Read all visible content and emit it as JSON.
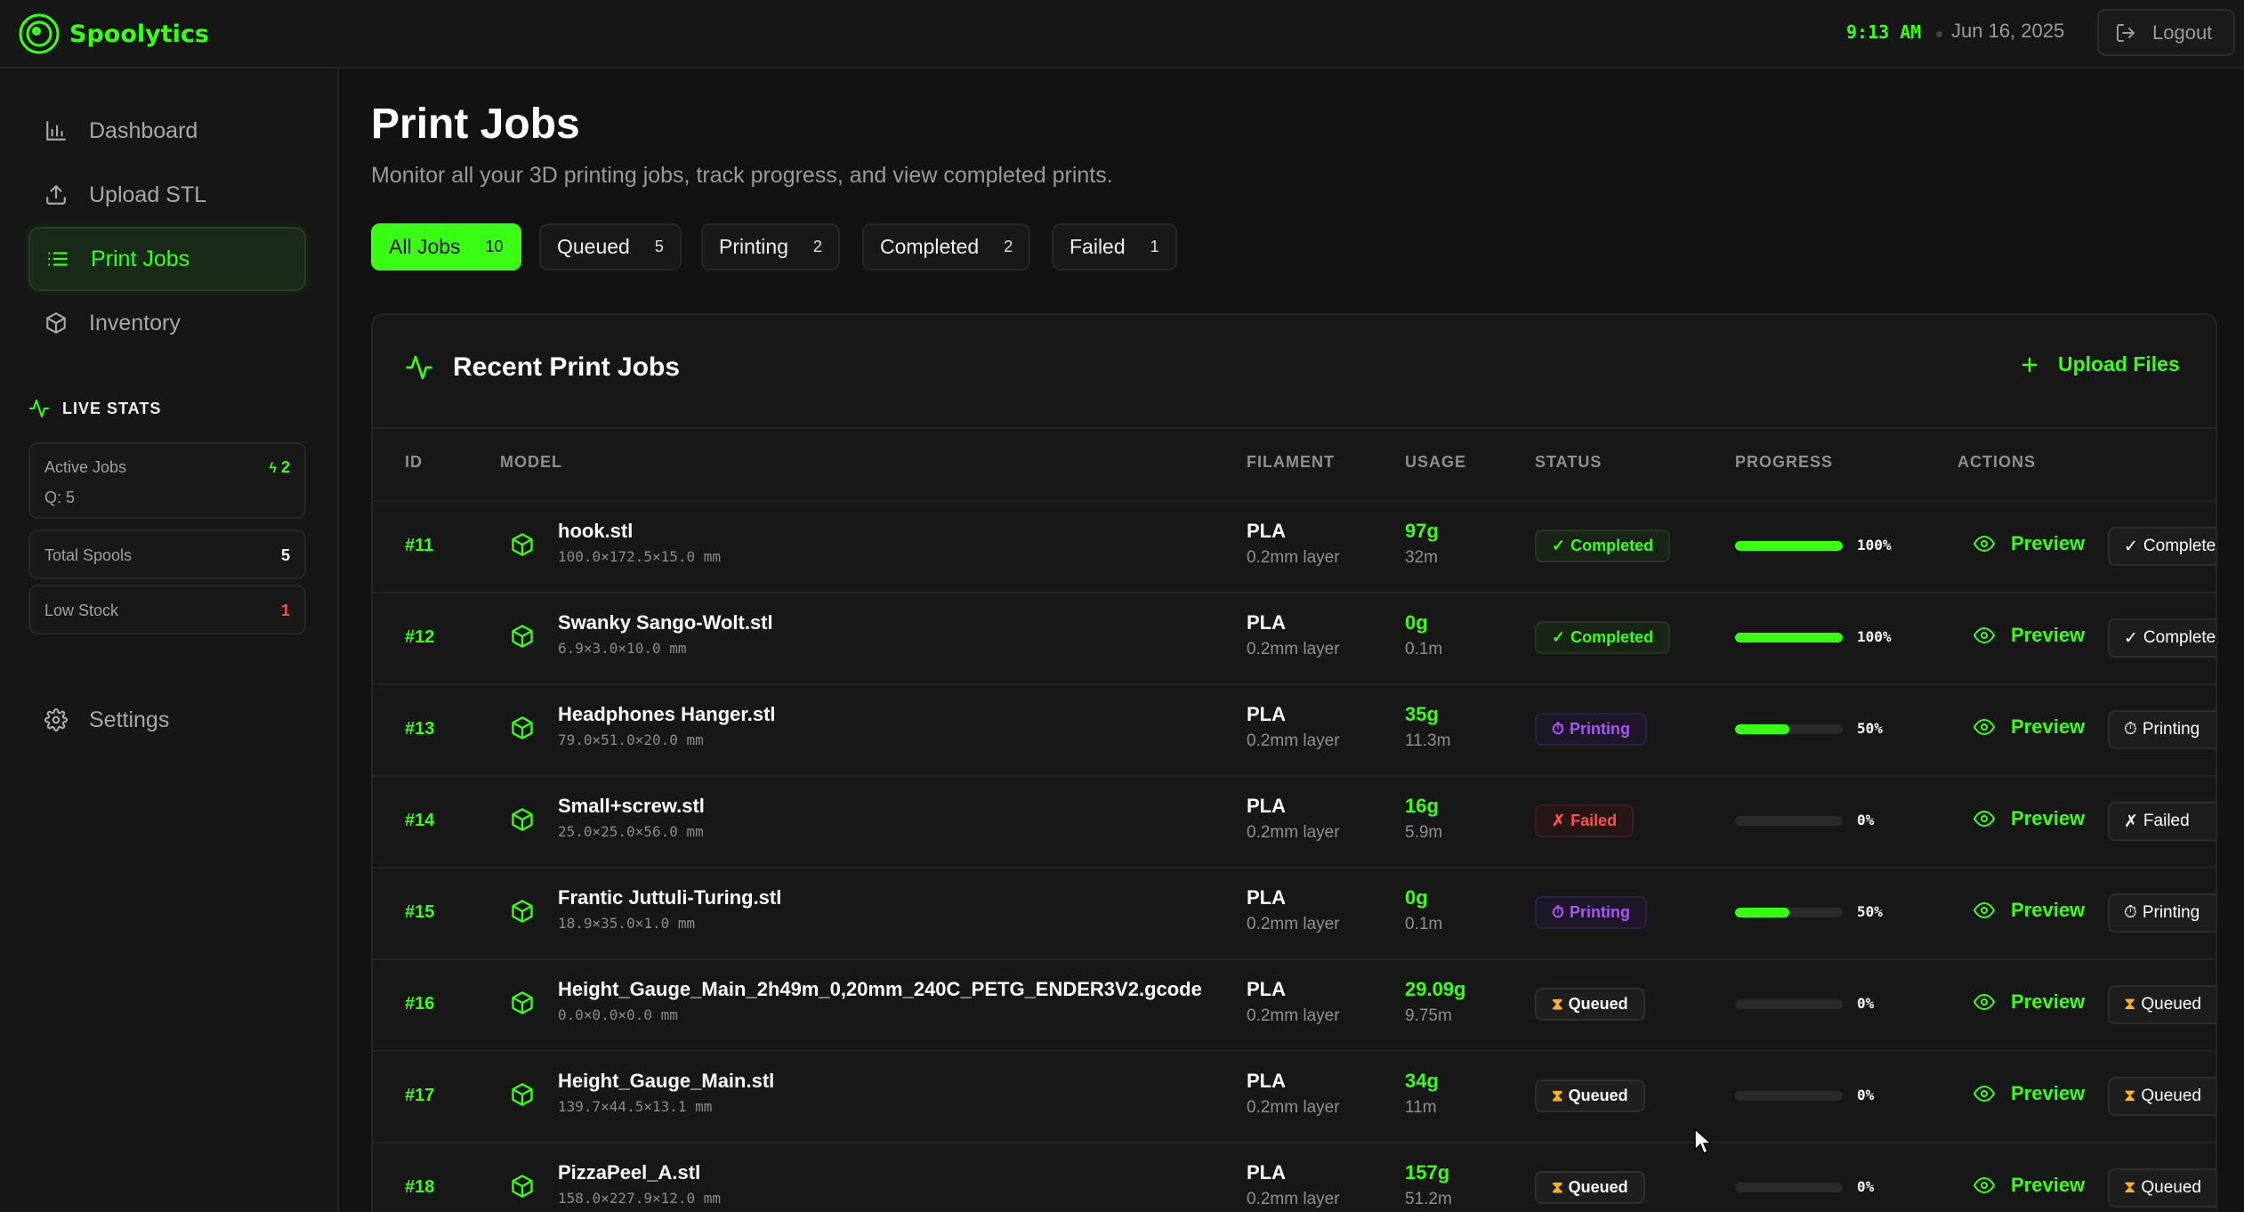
{
  "app": {
    "name": "Spoolytics"
  },
  "header": {
    "time": "9:13 AM",
    "date": "Jun 16, 2025",
    "logout_label": "Logout"
  },
  "colors": {
    "accent": "#39ff14",
    "printing": "#a855f7",
    "failed": "#ff4d4d",
    "queued_icon": "#ffb020",
    "background": "#121212"
  },
  "sidebar": {
    "items": [
      {
        "label": "Dashboard",
        "icon": "bar-chart-icon",
        "active": false
      },
      {
        "label": "Upload STL",
        "icon": "upload-icon",
        "active": false
      },
      {
        "label": "Print Jobs",
        "icon": "list-icon",
        "active": true
      },
      {
        "label": "Inventory",
        "icon": "box-icon",
        "active": false
      }
    ],
    "live_stats": {
      "title": "LIVE STATS",
      "active_jobs_label": "Active Jobs",
      "active_jobs_value": "2",
      "queue_text": "Q: 5",
      "total_spools_label": "Total Spools",
      "total_spools_value": "5",
      "low_stock_label": "Low Stock",
      "low_stock_value": "1"
    },
    "settings_label": "Settings"
  },
  "page": {
    "title": "Print Jobs",
    "subtitle": "Monitor all your 3D printing jobs, track progress, and view completed prints."
  },
  "tabs": [
    {
      "label": "All Jobs",
      "count": "10",
      "active": true
    },
    {
      "label": "Queued",
      "count": "5",
      "active": false
    },
    {
      "label": "Printing",
      "count": "2",
      "active": false
    },
    {
      "label": "Completed",
      "count": "2",
      "active": false
    },
    {
      "label": "Failed",
      "count": "1",
      "active": false
    }
  ],
  "panel": {
    "title": "Recent Print Jobs",
    "upload_label": "Upload Files",
    "columns": [
      "ID",
      "MODEL",
      "FILAMENT",
      "USAGE",
      "STATUS",
      "PROGRESS",
      "ACTIONS"
    ],
    "preview_label": "Preview"
  },
  "jobs": [
    {
      "id": "#11",
      "name": "hook.stl",
      "dims": "100.0×172.5×15.0 mm",
      "filament": "PLA",
      "layer": "0.2mm layer",
      "grams": "97g",
      "length": "32m",
      "status": "Completed",
      "status_icon": "✓",
      "progress": 100,
      "progress_label": "100%",
      "action": "Completed"
    },
    {
      "id": "#12",
      "name": "Swanky Sango-Wolt.stl",
      "dims": "6.9×3.0×10.0 mm",
      "filament": "PLA",
      "layer": "0.2mm layer",
      "grams": "0g",
      "length": "0.1m",
      "status": "Completed",
      "status_icon": "✓",
      "progress": 100,
      "progress_label": "100%",
      "action": "Completed"
    },
    {
      "id": "#13",
      "name": "Headphones Hanger.stl",
      "dims": "79.0×51.0×20.0 mm",
      "filament": "PLA",
      "layer": "0.2mm layer",
      "grams": "35g",
      "length": "11.3m",
      "status": "Printing",
      "status_icon": "⏱",
      "progress": 50,
      "progress_label": "50%",
      "action": "Printing"
    },
    {
      "id": "#14",
      "name": "Small+screw.stl",
      "dims": "25.0×25.0×56.0 mm",
      "filament": "PLA",
      "layer": "0.2mm layer",
      "grams": "16g",
      "length": "5.9m",
      "status": "Failed",
      "status_icon": "✗",
      "progress": 0,
      "progress_label": "0%",
      "action": "Failed"
    },
    {
      "id": "#15",
      "name": "Frantic Juttuli-Turing.stl",
      "dims": "18.9×35.0×1.0 mm",
      "filament": "PLA",
      "layer": "0.2mm layer",
      "grams": "0g",
      "length": "0.1m",
      "status": "Printing",
      "status_icon": "⏱",
      "progress": 50,
      "progress_label": "50%",
      "action": "Printing"
    },
    {
      "id": "#16",
      "name": "Height_Gauge_Main_2h49m_0,20mm_240C_PETG_ENDER3V2.gcode",
      "dims": "0.0×0.0×0.0 mm",
      "filament": "PLA",
      "layer": "0.2mm layer",
      "grams": "29.09g",
      "length": "9.75m",
      "status": "Queued",
      "status_icon": "⧗",
      "progress": 0,
      "progress_label": "0%",
      "action": "Queued"
    },
    {
      "id": "#17",
      "name": "Height_Gauge_Main.stl",
      "dims": "139.7×44.5×13.1 mm",
      "filament": "PLA",
      "layer": "0.2mm layer",
      "grams": "34g",
      "length": "11m",
      "status": "Queued",
      "status_icon": "⧗",
      "progress": 0,
      "progress_label": "0%",
      "action": "Queued"
    },
    {
      "id": "#18",
      "name": "PizzaPeel_A.stl",
      "dims": "158.0×227.9×12.0 mm",
      "filament": "PLA",
      "layer": "0.2mm layer",
      "grams": "157g",
      "length": "51.2m",
      "status": "Queued",
      "status_icon": "⧗",
      "progress": 0,
      "progress_label": "0%",
      "action": "Queued"
    }
  ]
}
